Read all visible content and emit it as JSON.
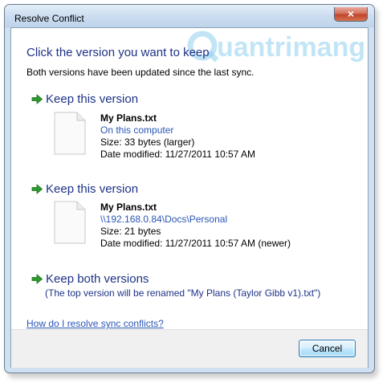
{
  "window": {
    "title": "Resolve Conflict",
    "close_glyph": "×"
  },
  "watermark": {
    "text": "Quantrimang"
  },
  "heading": "Click the version you want to keep",
  "subheading": "Both versions have been updated since the last sync.",
  "options": [
    {
      "label": "Keep this version",
      "icon": "green-arrow-icon",
      "file_name": "My Plans.txt",
      "location": "On this computer",
      "size": "Size: 33 bytes (larger)",
      "modified": "Date modified: 11/27/2011 10:57 AM"
    },
    {
      "label": "Keep this version",
      "icon": "green-arrow-icon",
      "file_name": "My Plans.txt",
      "location": "\\\\192.168.0.84\\Docs\\Personal",
      "size": "Size: 21 bytes",
      "modified": "Date modified: 11/27/2011 10:57 AM (newer)"
    },
    {
      "label": "Keep both versions",
      "icon": "green-arrow-icon",
      "note": "(The top version will be renamed \"My Plans (Taylor Gibb v1).txt\")"
    }
  ],
  "help_link": "How do I resolve sync conflicts?",
  "buttons": {
    "cancel": "Cancel"
  },
  "colors": {
    "heading_blue": "#1e3287",
    "link_blue": "#2a56b5",
    "arrow_green": "#2c9a2c",
    "frame": "#cfe0f1"
  }
}
